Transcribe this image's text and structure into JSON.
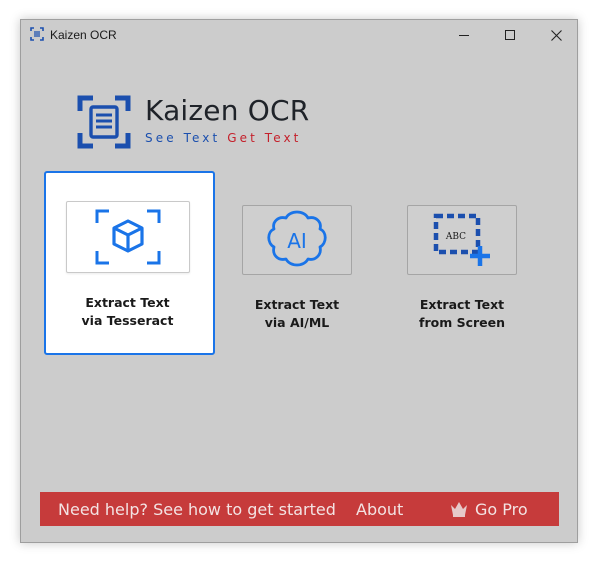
{
  "window": {
    "title": "Kaizen OCR",
    "controls": {
      "minimize_icon": "minimize-icon",
      "maximize_icon": "maximize-icon",
      "close_icon": "close-icon"
    }
  },
  "logo": {
    "title": "Kaizen OCR",
    "tagline_part1": "See Text",
    "tagline_part2": "Get Text",
    "colors": {
      "blue": "#1b4fae",
      "red": "#c41f2a"
    }
  },
  "options": [
    {
      "line1": "Extract Text",
      "line2": "via Tesseract",
      "icon": "cube-scan-icon",
      "selected": true
    },
    {
      "line1": "Extract Text",
      "line2": "via AI/ML",
      "icon": "ai-brain-icon",
      "selected": false
    },
    {
      "line1": "Extract Text",
      "line2": "from Screen",
      "icon": "screen-capture-icon",
      "selected": false
    }
  ],
  "footer": {
    "help": "Need help? See how to get started",
    "about": "About",
    "pro": "Go Pro",
    "pro_icon": "crown-icon",
    "background": "#c63b3b"
  },
  "accent": "#1a74e8"
}
